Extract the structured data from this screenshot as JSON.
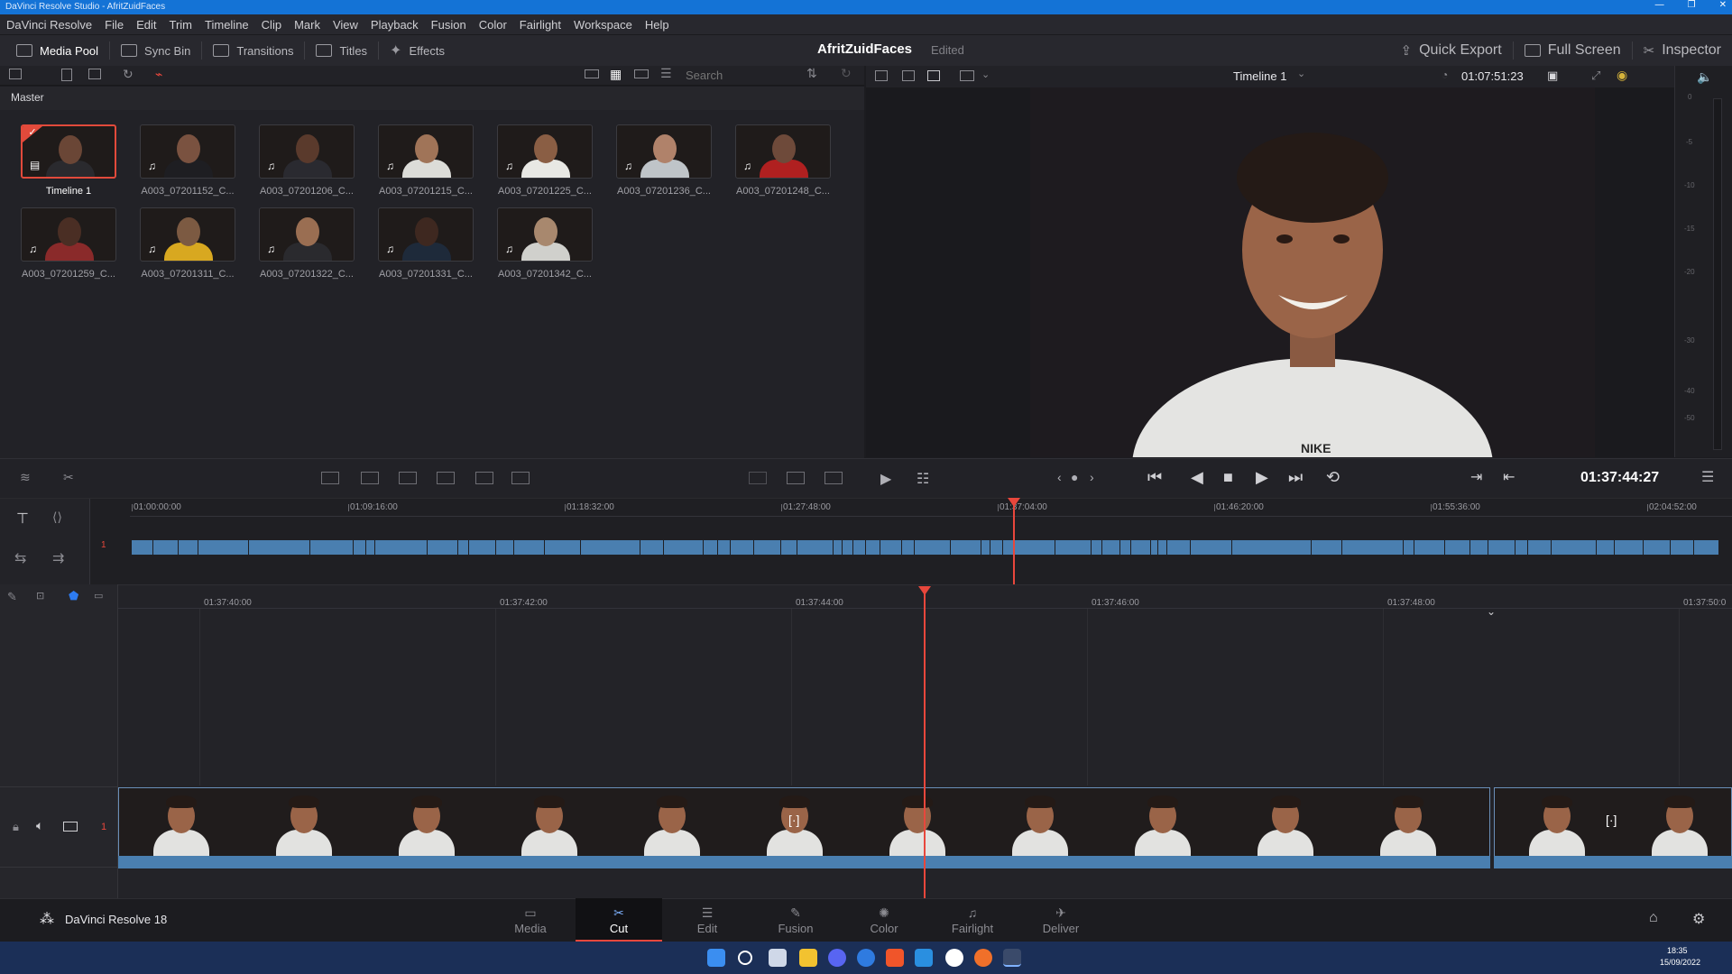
{
  "window": {
    "title": "DaVinci Resolve Studio - AfritZuidFaces"
  },
  "menu": [
    "DaVinci Resolve",
    "File",
    "Edit",
    "Trim",
    "Timeline",
    "Clip",
    "Mark",
    "View",
    "Playback",
    "Fusion",
    "Color",
    "Fairlight",
    "Workspace",
    "Help"
  ],
  "toolbar": {
    "media_pool": "Media Pool",
    "sync_bin": "Sync Bin",
    "transitions": "Transitions",
    "titles": "Titles",
    "effects": "Effects",
    "project_name": "AfritZuidFaces",
    "project_status": "Edited",
    "quick_export": "Quick Export",
    "full_screen": "Full Screen",
    "inspector": "Inspector"
  },
  "media_pool": {
    "search_placeholder": "Search",
    "bin": "Master",
    "clips": [
      {
        "label": "Timeline 1",
        "selected": true
      },
      {
        "label": "A003_07201152_C..."
      },
      {
        "label": "A003_07201206_C..."
      },
      {
        "label": "A003_07201215_C..."
      },
      {
        "label": "A003_07201225_C..."
      },
      {
        "label": "A003_07201236_C..."
      },
      {
        "label": "A003_07201248_C..."
      },
      {
        "label": "A003_07201259_C..."
      },
      {
        "label": "A003_07201311_C..."
      },
      {
        "label": "A003_07201322_C..."
      },
      {
        "label": "A003_07201331_C..."
      },
      {
        "label": "A003_07201342_C..."
      }
    ]
  },
  "viewer": {
    "timeline_name": "Timeline 1",
    "timecode_top": "01:07:51:23",
    "timecode_main": "01:37:44:27",
    "meter_labels": [
      "0",
      "-5",
      "-10",
      "-15",
      "-20",
      "-30",
      "-40",
      "-50"
    ]
  },
  "upper_ruler": [
    "01:00:00:00",
    "01:09:16:00",
    "01:18:32:00",
    "01:27:48:00",
    "01:37:04:00",
    "01:46:20:00",
    "01:55:36:00",
    "02:04:52:00"
  ],
  "lower_ruler": [
    "01:37:40:00",
    "01:37:42:00",
    "01:37:44:00",
    "01:37:46:00",
    "01:37:48:00",
    "01:37:50:0"
  ],
  "track_number": "1",
  "pages": [
    {
      "label": "Media",
      "icon": "▭"
    },
    {
      "label": "Cut",
      "icon": "✂",
      "active": true
    },
    {
      "label": "Edit",
      "icon": "☰"
    },
    {
      "label": "Fusion",
      "icon": "✎"
    },
    {
      "label": "Color",
      "icon": "✺"
    },
    {
      "label": "Fairlight",
      "icon": "♫"
    },
    {
      "label": "Deliver",
      "icon": "✈"
    }
  ],
  "app_brand": "DaVinci Resolve 18",
  "system_tray": {
    "time": "18:35",
    "date": "15/09/2022"
  },
  "colors": {
    "accent": "#e8473c",
    "clip_blue": "#4a7fb0",
    "titlebar": "#1473d6",
    "taskbar": "#1b2f57"
  }
}
